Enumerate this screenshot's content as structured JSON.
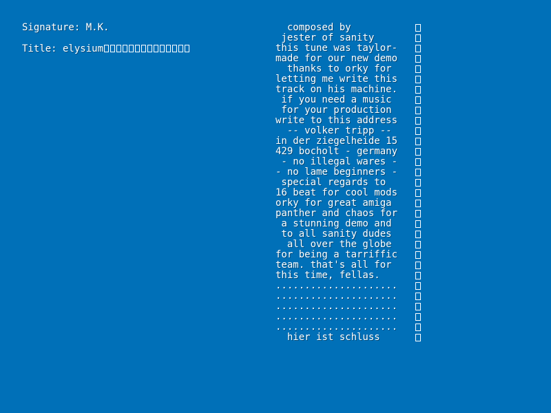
{
  "background_color": "#0070B8",
  "text_color": "#FFFFFF",
  "module_info": {
    "signature_label": "Signature: M.K.",
    "title_label": "Title: elysium",
    "title_placeholder_glyph_count": 14
  },
  "sample_names": [
    "  composed by     ",
    " jester of sanity ",
    "this tune was taylor-",
    "made for our new demo",
    "  thanks to orky for ",
    "letting me write this",
    "track on his machine.",
    " if you need a music ",
    " for your production ",
    "write to this address",
    "  -- volker tripp -- ",
    "in der ziegelheide 15",
    "429 bocholt - germany",
    " - no illegal wares -",
    "- no lame beginners -",
    " special regards to  ",
    "16 beat for cool mods",
    "orky for great amiga ",
    "panther and chaos for",
    " a stunning demo and ",
    " to all sanity dudes ",
    "  all over the globe ",
    "for being a tarriffic",
    "team. that's all for ",
    "this time, fellas.   ",
    ".....................",
    ".....................",
    ".....................",
    ".....................",
    ".....................",
    "  hier ist schluss   "
  ]
}
